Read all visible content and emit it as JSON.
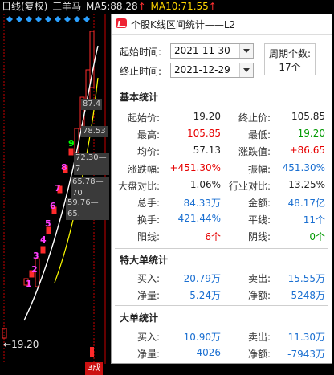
{
  "header": {
    "chart_type": "日线(复权)",
    "stock_name": "三羊马",
    "ma5_label": "MA5:",
    "ma5_value": "88.28",
    "ma5_arrow": "↑",
    "ma10_label": "MA10:",
    "ma10_value": "71.55",
    "ma10_arrow": "↑"
  },
  "chart": {
    "low_label": "19.20",
    "low_arrow": "←",
    "day_numbers": [
      "1",
      "2",
      "3",
      "4",
      "5",
      "6",
      "7",
      "8",
      "9"
    ],
    "price_boxes": [
      "87.4",
      "78.53",
      "72.30",
      "65.78",
      "59.76"
    ],
    "price_box_suffix": [
      "",
      "",
      "—7",
      "—70",
      "—65."
    ],
    "bottom_tag": "3成",
    "colors": {
      "up": "#ff2b2b",
      "down": "#00ff00",
      "magenta": "#ff40ff",
      "ma5": "#ffffff",
      "ma10": "#ffff00",
      "grid": "#c80000"
    }
  },
  "dialog": {
    "title": "个股K线区间统计——L2",
    "start_label": "起始时间:",
    "start_value": "2021-11-30",
    "end_label": "终止时间:",
    "end_value": "2021-12-29",
    "period_label": "周期个数:",
    "period_value": "17个",
    "basic": {
      "title": "基本统计",
      "rows": [
        {
          "l1": "起始价:",
          "v1": "19.20",
          "c1": "dark",
          "l2": "终止价:",
          "v2": "105.85",
          "c2": "dark"
        },
        {
          "l1": "最高:",
          "v1": "105.85",
          "c1": "red",
          "l2": "最低:",
          "v2": "19.20",
          "c2": "green"
        },
        {
          "l1": "均价:",
          "v1": "57.13",
          "c1": "dark",
          "l2": "涨跌值:",
          "v2": "+86.65",
          "c2": "red"
        },
        {
          "l1": "涨跌幅:",
          "v1": "+451.30%",
          "c1": "red",
          "l2": "振幅:",
          "v2": "451.30%",
          "c2": "blue"
        },
        {
          "l1": "大盘对比:",
          "v1": "-1.06%",
          "c1": "dark",
          "l2": "行业对比:",
          "v2": "13.25%",
          "c2": "dark"
        },
        {
          "l1": "总手:",
          "v1": "84.33万",
          "c1": "blue",
          "l2": "金额:",
          "v2": "48.17亿",
          "c2": "blue"
        },
        {
          "l1": "换手:",
          "v1": "421.44%",
          "c1": "blue",
          "l2": "平线:",
          "v2": "11个",
          "c2": "blue"
        },
        {
          "l1": "阳线:",
          "v1": "6个",
          "c1": "red",
          "l2": "阴线:",
          "v2": "0个",
          "c2": "green"
        }
      ]
    },
    "special": {
      "title": "特大单统计",
      "rows": [
        {
          "l1": "买入:",
          "v1": "20.79万",
          "c1": "blue",
          "l2": "卖出:",
          "v2": "15.55万",
          "c2": "blue"
        },
        {
          "l1": "净量:",
          "v1": "5.24万",
          "c1": "blue",
          "l2": "净额:",
          "v2": "5248万",
          "c2": "blue"
        }
      ]
    },
    "large": {
      "title": "大单统计",
      "rows": [
        {
          "l1": "买入:",
          "v1": "10.90万",
          "c1": "blue",
          "l2": "卖出:",
          "v2": "11.30万",
          "c2": "blue"
        },
        {
          "l1": "净量:",
          "v1": "-4026",
          "c1": "blue",
          "l2": "净额:",
          "v2": "-7943万",
          "c2": "blue"
        }
      ]
    }
  }
}
